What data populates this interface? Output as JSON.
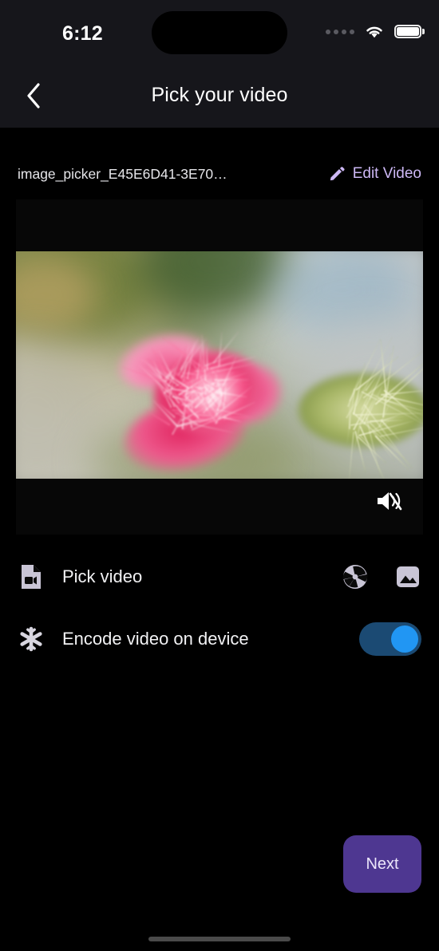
{
  "status_bar": {
    "time": "6:12",
    "cellular_icon": "signal-dots-icon",
    "wifi_icon": "wifi-icon",
    "battery_icon": "battery-full-icon"
  },
  "header": {
    "back_icon": "chevron-left-icon",
    "title": "Pick your video"
  },
  "file_row": {
    "filename": "image_picker_E45E6D41-3E70…",
    "edit_icon": "pencil-icon",
    "edit_label": "Edit Video",
    "edit_color": "#cdb8f5"
  },
  "player": {
    "mute_icon": "speaker-muted-icon",
    "muted": true,
    "media_description": "Blurred macro photo of a pink thistle flower with green spiny bract"
  },
  "options": [
    {
      "icon": "video-file-icon",
      "label": "Pick video",
      "actions": [
        {
          "icon": "camera-aperture-icon"
        },
        {
          "icon": "photo-gallery-icon"
        }
      ]
    },
    {
      "icon": "snowflake-icon",
      "label": "Encode video on device",
      "toggle": {
        "state": "on",
        "track_color": "#1b4a73",
        "knob_color": "#2196f3"
      }
    }
  ],
  "footer": {
    "next_label": "Next",
    "next_color": "#4e3791"
  },
  "home_indicator": "home-indicator"
}
